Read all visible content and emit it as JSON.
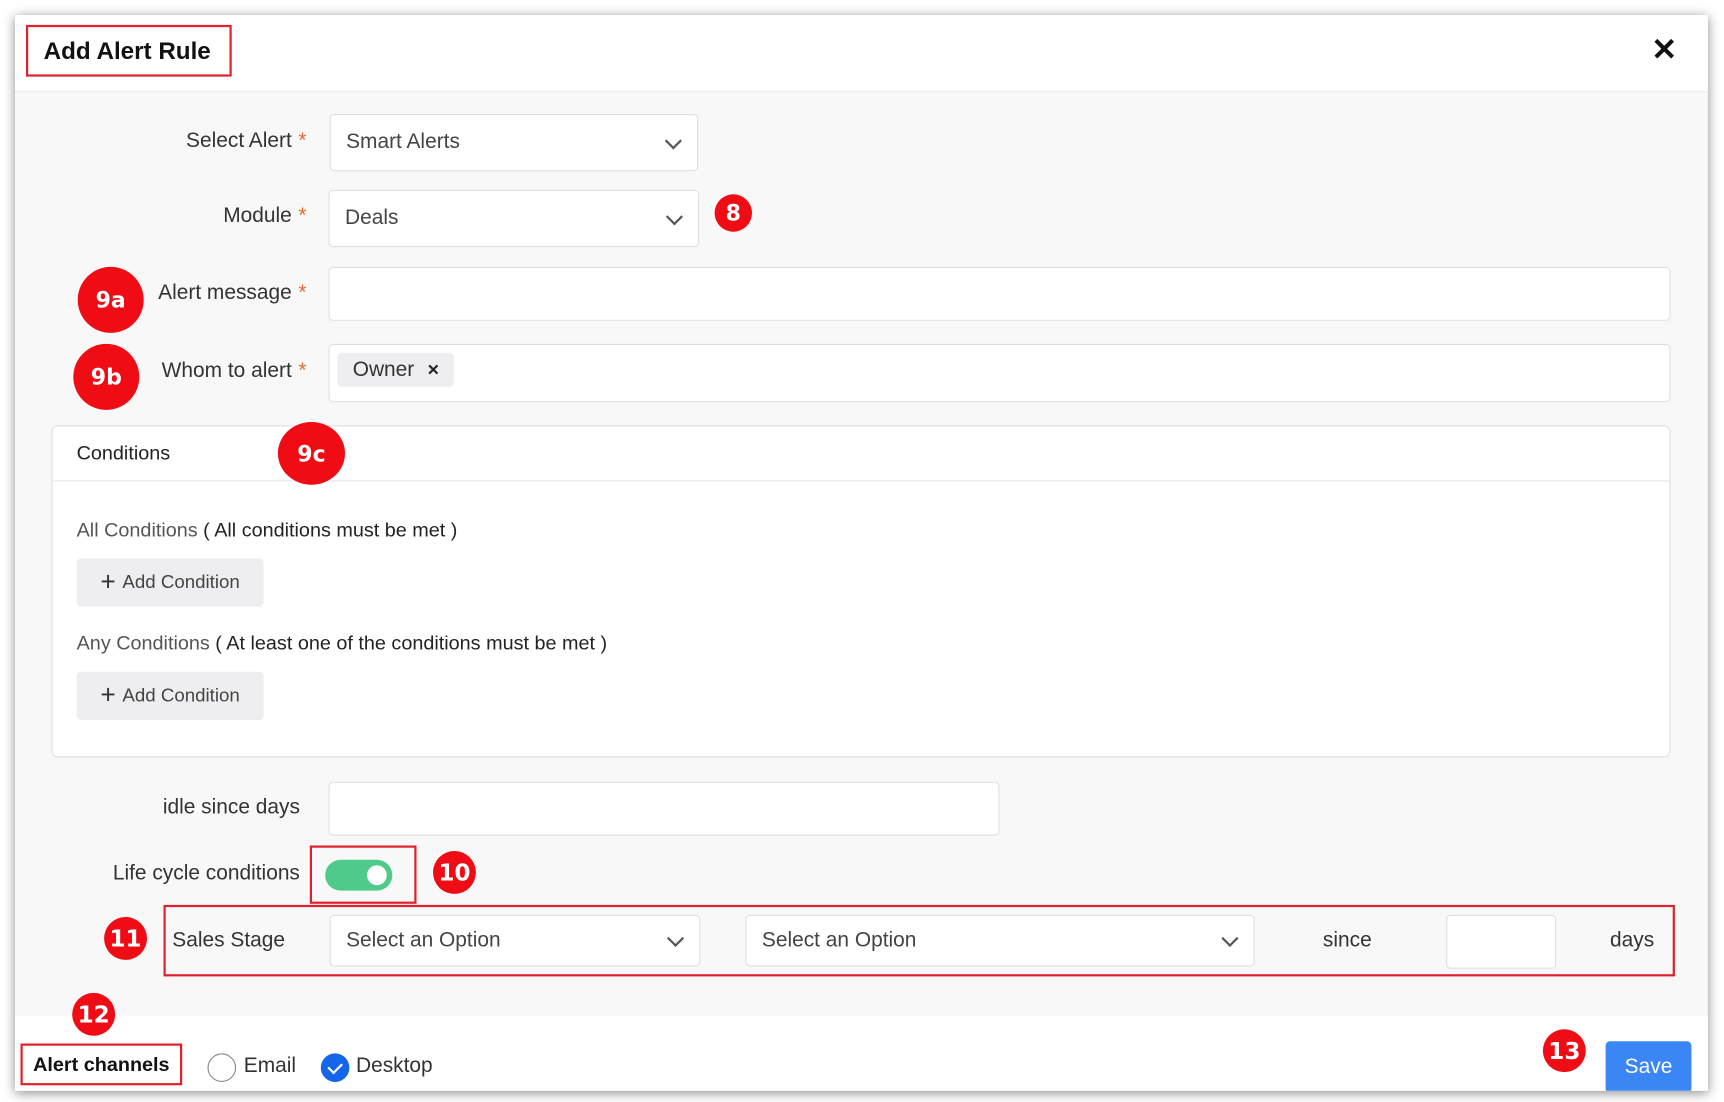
{
  "dialog": {
    "title": "Add Alert Rule",
    "close_icon": "close-icon"
  },
  "form": {
    "select_alert": {
      "label": "Select Alert",
      "value": "Smart Alerts"
    },
    "module": {
      "label": "Module",
      "value": "Deals"
    },
    "alert_message": {
      "label": "Alert message",
      "value": ""
    },
    "whom_to_alert": {
      "label": "Whom to alert",
      "chips": [
        "Owner"
      ]
    },
    "required_mark": "*"
  },
  "conditions": {
    "title": "Conditions",
    "all_label": "All Conditions",
    "all_hint": "( All conditions must be met )",
    "any_label": "Any Conditions",
    "any_hint": "( At least one of the conditions must be met )",
    "add_label": "Add Condition"
  },
  "idle": {
    "label": "idle since days",
    "value": ""
  },
  "lifecycle": {
    "label": "Life cycle conditions",
    "enabled": true,
    "field": "Sales Stage",
    "option1": "Select an Option",
    "option2": "Select an Option",
    "since": "since",
    "days_value": "",
    "days": "days"
  },
  "channels": {
    "label": "Alert channels",
    "email": {
      "label": "Email",
      "checked": false
    },
    "desktop": {
      "label": "Desktop",
      "checked": true
    }
  },
  "save_label": "Save",
  "callouts": {
    "c8": "8",
    "c9a": "9a",
    "c9b": "9b",
    "c9c": "9c",
    "c10": "10",
    "c11": "11",
    "c12": "12",
    "c13": "13"
  },
  "colors": {
    "callout": "#ef0c14",
    "highlight_border": "#e0202a",
    "primary": "#3a86f5",
    "toggle_on": "#4ecb8b",
    "required": "#ea6a2e"
  }
}
